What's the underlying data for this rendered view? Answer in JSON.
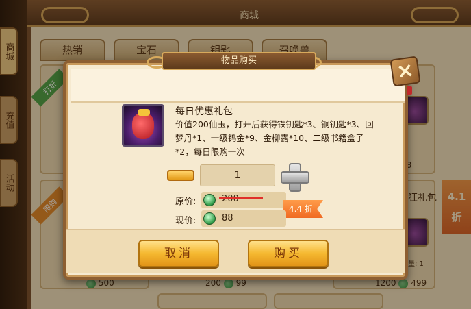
{
  "shop": {
    "title": "商城",
    "tabs": [
      "热销",
      "宝石",
      "钥匙",
      "召唤兽"
    ],
    "side_tabs": [
      "商城",
      "充值",
      "活动"
    ],
    "ribbon_1": "打折",
    "ribbon_2": "限购",
    "bg_count_1": "58",
    "bg_item_right": "狂礼包",
    "bg_qty_label": "数量: 1",
    "bg_price_1": "500",
    "bg_price_2": "200",
    "bg_price_3": "99",
    "bg_price_4": "1200",
    "bg_price_5": "499",
    "discount_flag": "4.1 折"
  },
  "modal": {
    "title": "物品购买",
    "close_label": "×",
    "item": {
      "name": "每日优惠礼包",
      "description": "价值200仙玉，打开后获得铁钥匙*3、铜钥匙*3、回梦丹*1、一级钨金*9、金柳露*10、二级书籍盒子*2，每日限购一次",
      "icon": "red-lucky-bag-icon"
    },
    "quantity": "1",
    "original_price_label": "原价:",
    "original_price": "200",
    "current_price_label": "现价:",
    "current_price": "88",
    "discount_label": "4.4 折",
    "cancel_label": "取消",
    "buy_label": "购买"
  },
  "colors": {
    "button_gold": "#f5b830",
    "discount_orange": "#f06a22",
    "strike_red": "#e0302a",
    "frame_brown": "#8d5f32"
  }
}
